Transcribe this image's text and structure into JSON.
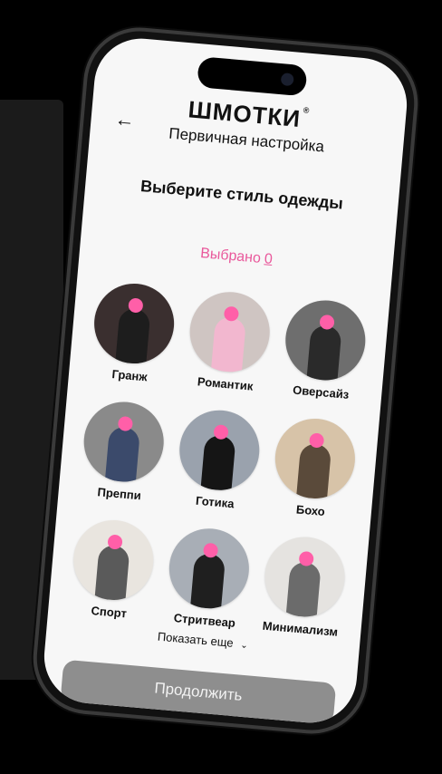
{
  "brand": {
    "name": "ШМОТКИ",
    "mark": "®"
  },
  "header": {
    "back_icon": "←",
    "subtitle": "Первичная настройка"
  },
  "main": {
    "heading": "Выберите стиль одежды",
    "selected_label": "Выбрано",
    "selected_count": "0"
  },
  "styles": [
    {
      "label": "Гранж",
      "bg": "#3a2f2f",
      "body": "#1d1d1d"
    },
    {
      "label": "Романтик",
      "bg": "#cfc5c2",
      "body": "#f2b7cf"
    },
    {
      "label": "Оверсайз",
      "bg": "#6e6e6e",
      "body": "#2a2a2a"
    },
    {
      "label": "Преппи",
      "bg": "#8a8a8a",
      "body": "#3b4a6b"
    },
    {
      "label": "Готика",
      "bg": "#9aa2ad",
      "body": "#151515"
    },
    {
      "label": "Бохо",
      "bg": "#d7c3a8",
      "body": "#5a4a3a"
    },
    {
      "label": "Спорт",
      "bg": "#e9e5df",
      "body": "#5a5a5a"
    },
    {
      "label": "Стритвеар",
      "bg": "#a8aeb6",
      "body": "#1f1f1f"
    },
    {
      "label": "Минимализм",
      "bg": "#e5e3e0",
      "body": "#6b6b6b"
    }
  ],
  "footer": {
    "more_label": "Показать еще",
    "continue_label": "Продолжить"
  },
  "colors": {
    "accent": "#e9589b",
    "button_bg": "#8e8e8e"
  }
}
